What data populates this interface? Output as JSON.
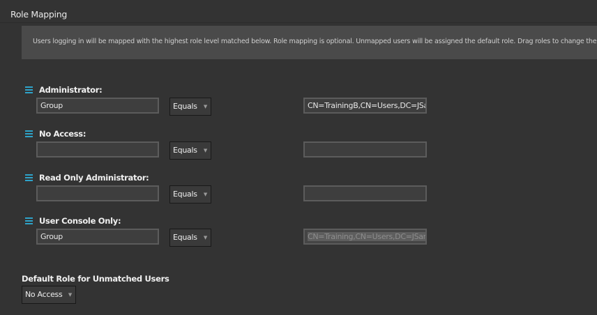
{
  "page": {
    "title": "Role Mapping"
  },
  "info": {
    "text": "Users logging in will be mapped with the highest role level matched below. Role mapping is optional. Unmapped users will be assigned the default role. Drag roles to change the priority"
  },
  "icons": {
    "drag_handle": "drag-handle-icon",
    "dropdown_caret": "chevron-down-icon"
  },
  "colors": {
    "accent": "#2ea3c9",
    "background": "#333333",
    "info_background": "#4a4a4a"
  },
  "roles": [
    {
      "label": "Administrator:",
      "attribute": "Group",
      "operator": "Equals",
      "value": "CN=TrainingB,CN=Users,DC=JSan"
    },
    {
      "label": "No Access:",
      "attribute": "",
      "operator": "Equals",
      "value": ""
    },
    {
      "label": "Read Only Administrator:",
      "attribute": "",
      "operator": "Equals",
      "value": ""
    },
    {
      "label": "User Console Only:",
      "attribute": "Group",
      "operator": "Equals",
      "value": "CN=Training,CN=Users,DC=JSant"
    }
  ],
  "dropdown_caret_glyph": "▼",
  "default_role": {
    "label": "Default Role for Unmatched Users",
    "value": "No Access"
  }
}
